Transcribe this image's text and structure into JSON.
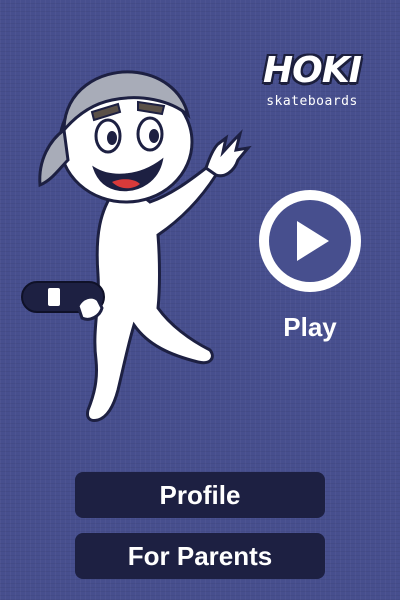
{
  "logo": {
    "word": "HOKI",
    "subtitle": "skateboards"
  },
  "play": {
    "label": "Play",
    "icon": "play-icon"
  },
  "menu": {
    "profile_label": "Profile",
    "parents_label": "For Parents"
  },
  "colors": {
    "background": "#474f8e",
    "button": "#1d2042",
    "text": "#ffffff"
  }
}
